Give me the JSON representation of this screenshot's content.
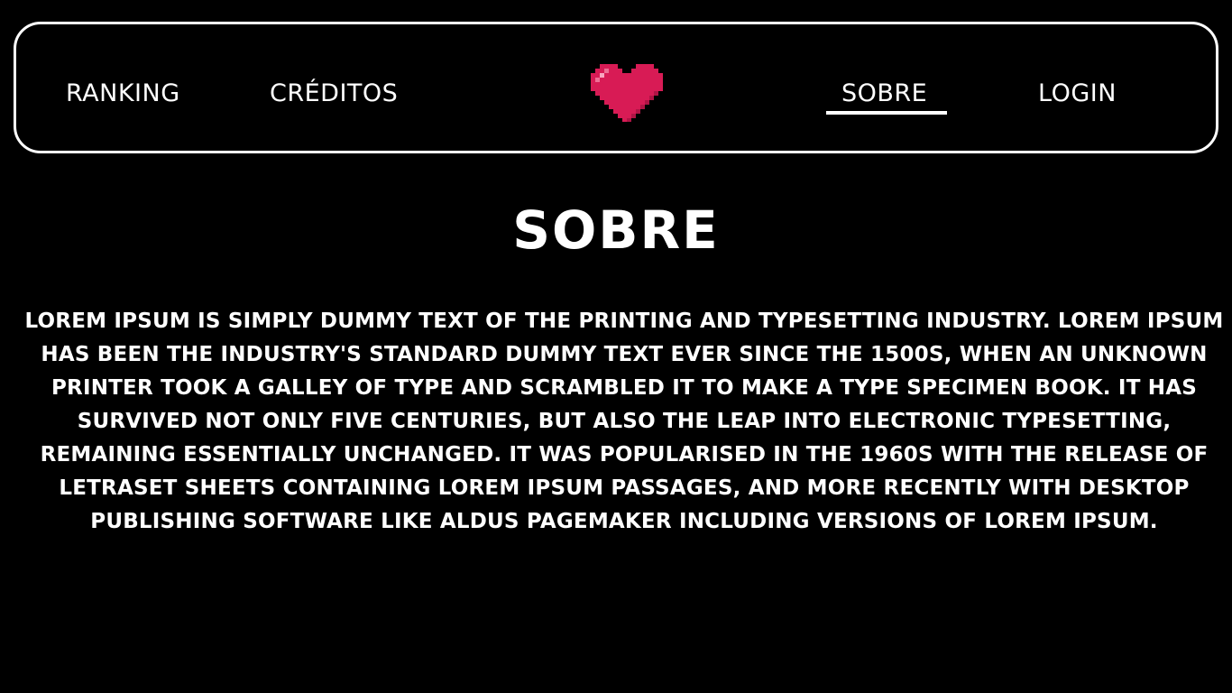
{
  "nav": {
    "ranking_label": "RANKING",
    "creditos_label": "CRÉDITOS",
    "sobre_label": "SOBRE",
    "login_label": "LOGIN",
    "active_item": "SOBRE",
    "logo_icon": "pixel-heart-icon"
  },
  "main": {
    "title": "SOBRE",
    "body": "LOREM IPSUM IS SIMPLY DUMMY TEXT OF THE PRINTING AND TYPESETTING INDUSTRY. LOREM IPSUM HAS BEEN THE INDUSTRY'S STANDARD DUMMY TEXT EVER SINCE THE 1500S, WHEN AN UNKNOWN PRINTER TOOK A GALLEY OF TYPE AND SCRAMBLED IT TO MAKE A TYPE SPECIMEN BOOK. IT HAS SURVIVED NOT ONLY FIVE CENTURIES, BUT ALSO THE LEAP INTO ELECTRONIC TYPESETTING, REMAINING ESSENTIALLY UNCHANGED. IT WAS POPULARISED IN THE 1960S WITH THE RELEASE OF LETRASET SHEETS CONTAINING LOREM IPSUM PASSAGES, AND MORE RECENTLY WITH DESKTOP PUBLISHING SOFTWARE LIKE ALDUS PAGEMAKER INCLUDING VERSIONS OF LOREM IPSUM."
  },
  "colors": {
    "background": "#000000",
    "text": "#ffffff",
    "heart": "#d81b55",
    "heart_shadow": "#b01445",
    "heart_highlight": "#f7a6bf"
  }
}
